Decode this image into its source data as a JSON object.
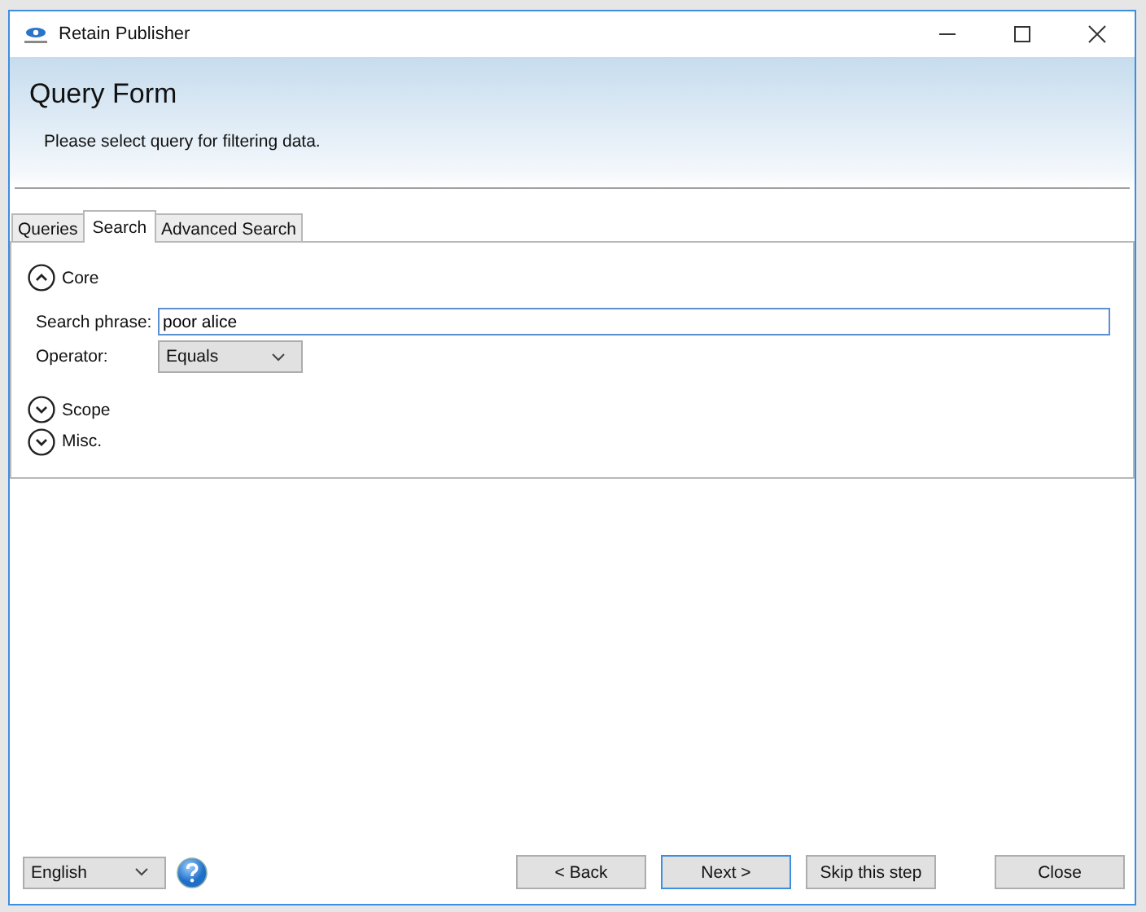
{
  "window": {
    "title": "Retain Publisher"
  },
  "header": {
    "title": "Query Form",
    "subtitle": "Please select query for filtering data."
  },
  "tabs": [
    {
      "label": "Queries",
      "selected": false
    },
    {
      "label": "Search",
      "selected": true
    },
    {
      "label": "Advanced Search",
      "selected": false
    }
  ],
  "sections": [
    {
      "title": "Core",
      "expanded": true,
      "fields": [
        {
          "kind": "text",
          "label": "Search phrase:",
          "value": "poor alice"
        },
        {
          "kind": "dropdown",
          "label": "Operator:",
          "value": "Equals"
        }
      ]
    },
    {
      "title": "Scope",
      "expanded": false
    },
    {
      "title": "Misc.",
      "expanded": false
    }
  ],
  "footer": {
    "language": "English",
    "buttons": [
      {
        "label": "< Back",
        "default": false
      },
      {
        "label": "Next >",
        "default": true
      },
      {
        "label": "Skip this step",
        "default": false
      },
      {
        "label": "Close",
        "default": false
      }
    ]
  }
}
